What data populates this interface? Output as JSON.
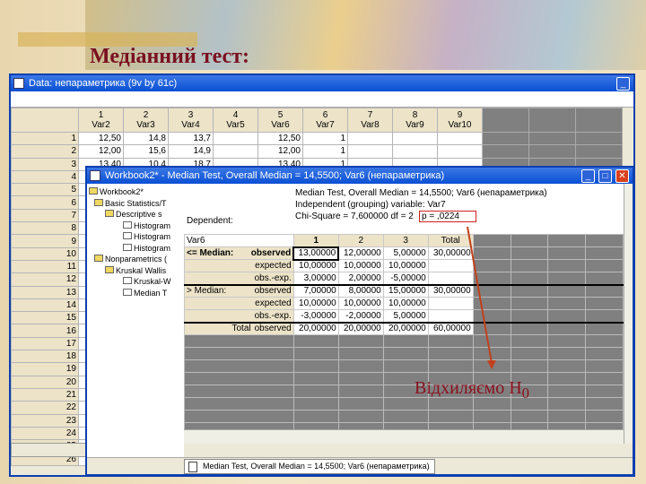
{
  "slide": {
    "title": "Медіанний тест:",
    "annotation": "Відхиляємо H",
    "annotation_sub": "0"
  },
  "data_window": {
    "title": "Data: непараметрика (9v by 61c)",
    "columns": [
      {
        "num": "1",
        "name": "Var2"
      },
      {
        "num": "2",
        "name": "Var3"
      },
      {
        "num": "3",
        "name": "Var4"
      },
      {
        "num": "4",
        "name": "Var5"
      },
      {
        "num": "5",
        "name": "Var6"
      },
      {
        "num": "6",
        "name": "Var7"
      },
      {
        "num": "7",
        "name": "Var8"
      },
      {
        "num": "8",
        "name": "Var9"
      },
      {
        "num": "9",
        "name": "Var10"
      }
    ],
    "rows": [
      [
        "12,50",
        "14,8",
        "13,7",
        "",
        "12,50",
        "1",
        "",
        "",
        ""
      ],
      [
        "12,00",
        "15,6",
        "14,9",
        "",
        "12,00",
        "1",
        "",
        "",
        ""
      ],
      [
        "13,40",
        "10,4",
        "18,7",
        "",
        "13,40",
        "1",
        "",
        "",
        ""
      ]
    ],
    "row_numbers": [
      "1",
      "2",
      "3",
      "4",
      "5",
      "6",
      "7",
      "8",
      "9",
      "10",
      "11",
      "12",
      "13",
      "14",
      "15",
      "16",
      "17",
      "18",
      "19",
      "20",
      "21",
      "22",
      "23",
      "24",
      "25",
      "26"
    ]
  },
  "workbook": {
    "title": "Workbook2* - Median Test, Overall Median = 14,5500; Var6 (непараметрика)",
    "tree": [
      "Workbook2*",
      "Basic Statistics/T",
      "Descriptive s",
      "Histogram",
      "Histogram",
      "Histogram",
      "Nonparametrics (",
      "Kruskal Wallis",
      "Kruskal-W",
      "Median T"
    ],
    "header_lines": [
      "Median Test, Overall Median = 14,5500; Var6 (непараметрика)",
      "Independent (grouping) variable: Var7",
      "Chi-Square = 7,600000 df = 2"
    ],
    "p_value": "p = ,0224",
    "dependent_label": "Dependent:",
    "dependent_var": "Var6",
    "col_headers": [
      "1",
      "2",
      "3",
      "Total"
    ],
    "rows": [
      {
        "group": "<= Median:",
        "stat": "observed",
        "values": [
          "13,00000",
          "12,00000",
          "5,00000",
          "30,00000"
        ]
      },
      {
        "group": "",
        "stat": "expected",
        "values": [
          "10,00000",
          "10,00000",
          "10,00000",
          ""
        ]
      },
      {
        "group": "",
        "stat": "obs.-exp.",
        "values": [
          "3,00000",
          "2,00000",
          "-5,00000",
          ""
        ]
      },
      {
        "group": "> Median:",
        "stat": "observed",
        "values": [
          "7,00000",
          "8,00000",
          "15,00000",
          "30,00000"
        ]
      },
      {
        "group": "",
        "stat": "expected",
        "values": [
          "10,00000",
          "10,00000",
          "10,00000",
          ""
        ]
      },
      {
        "group": "",
        "stat": "obs.-exp.",
        "values": [
          "-3,00000",
          "-2,00000",
          "5,00000",
          ""
        ]
      },
      {
        "group": "Total",
        "stat": "observed",
        "values": [
          "20,00000",
          "20,00000",
          "20,00000",
          "60,00000"
        ]
      }
    ],
    "tab_label": "Median Test, Overall Median = 14,5500; Var6 (непараметрика)"
  },
  "colors": {
    "accent": "#8a0f1c",
    "titlebar": "#0a4fd4"
  }
}
